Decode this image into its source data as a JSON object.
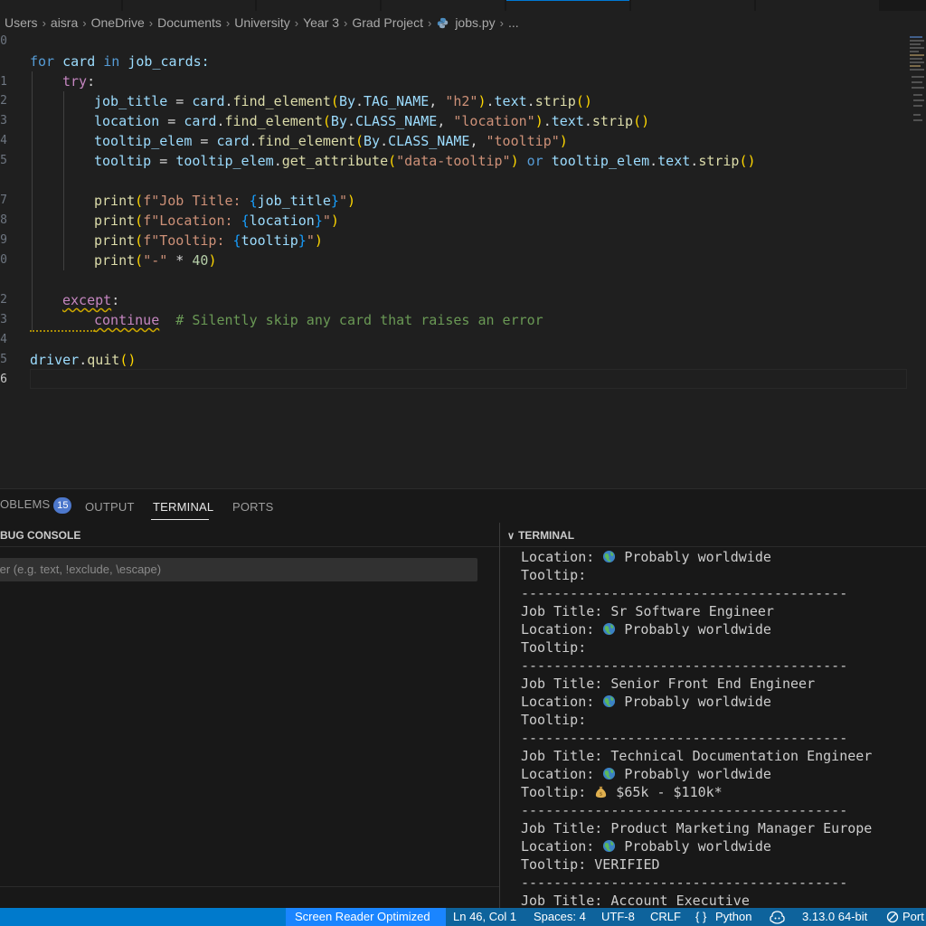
{
  "breadcrumb": [
    "Users",
    "aisra",
    "OneDrive",
    "Documents",
    "University",
    "Year 3",
    "Grad Project",
    "jobs.py",
    "..."
  ],
  "editor": {
    "line_numbers": [
      "0",
      "1",
      "2",
      "3",
      "4",
      "5",
      "",
      "7",
      "8",
      "9",
      "0",
      "",
      "2",
      "3",
      "4",
      "5",
      "6"
    ],
    "code": {
      "l0": [
        "for",
        " card ",
        "in",
        " job_cards:"
      ],
      "l1": [
        "try",
        ":"
      ],
      "l2": [
        "job_title",
        " = ",
        "card",
        ".",
        "find_element",
        "(",
        "By",
        ".",
        "TAG_NAME",
        ", ",
        "\"h2\"",
        ")",
        ".",
        "text",
        ".",
        "strip",
        "()"
      ],
      "l3": [
        "location",
        " = ",
        "card",
        ".",
        "find_element",
        "(",
        "By",
        ".",
        "CLASS_NAME",
        ", ",
        "\"location\"",
        ")",
        ".",
        "text",
        ".",
        "strip",
        "()"
      ],
      "l4": [
        "tooltip_elem",
        " = ",
        "card",
        ".",
        "find_element",
        "(",
        "By",
        ".",
        "CLASS_NAME",
        ", ",
        "\"tooltip\"",
        ")"
      ],
      "l5": [
        "tooltip",
        " = ",
        "tooltip_elem",
        ".",
        "get_attribute",
        "(",
        "\"data-tooltip\"",
        ") ",
        "or",
        " tooltip_elem",
        ".",
        "text",
        ".",
        "strip",
        "()"
      ],
      "l7": [
        "print",
        "(",
        "f\"Job Title: ",
        "{",
        "job_title",
        "}",
        "\"",
        ")"
      ],
      "l8": [
        "print",
        "(",
        "f\"Location: ",
        "{",
        "location",
        "}",
        "\"",
        ")"
      ],
      "l9": [
        "print",
        "(",
        "f\"Tooltip: ",
        "{",
        "tooltip",
        "}",
        "\"",
        ")"
      ],
      "l10": [
        "print",
        "(",
        "\"-\"",
        " * ",
        "40",
        ")"
      ],
      "l12": [
        "except",
        ":"
      ],
      "l13": [
        "continue",
        "  # Silently skip any card that raises an error"
      ],
      "l15": [
        "driver",
        ".",
        "quit",
        "()"
      ]
    }
  },
  "panel": {
    "tabs": [
      {
        "label": "OBLEMS"
      },
      {
        "label": "OUTPUT"
      },
      {
        "label": "TERMINAL"
      },
      {
        "label": "PORTS"
      }
    ],
    "problems_count": "15",
    "debug_header": "BUG CONSOLE",
    "debug_filter_placeholder": "ter (e.g. text, !exclude, \\escape)",
    "terminal_header": "TERMINAL",
    "terminal_lines": [
      {
        "text": "Location: ",
        "emoji": "globe",
        "rest": " Probably worldwide"
      },
      {
        "text": "Tooltip:"
      },
      {
        "text": "----------------------------------------"
      },
      {
        "text": "Job Title: Sr Software Engineer"
      },
      {
        "text": "Location: ",
        "emoji": "globe",
        "rest": " Probably worldwide"
      },
      {
        "text": "Tooltip:"
      },
      {
        "text": "----------------------------------------"
      },
      {
        "text": "Job Title: Senior Front End Engineer"
      },
      {
        "text": "Location: ",
        "emoji": "globe",
        "rest": " Probably worldwide"
      },
      {
        "text": "Tooltip:"
      },
      {
        "text": "----------------------------------------"
      },
      {
        "text": "Job Title: Technical Documentation Engineer"
      },
      {
        "text": "Location: ",
        "emoji": "globe",
        "rest": " Probably worldwide"
      },
      {
        "text": "Tooltip: ",
        "emoji": "money-bag",
        "rest": " $65k - $110k*"
      },
      {
        "text": "----------------------------------------"
      },
      {
        "text": "Job Title: Product Marketing Manager Europe"
      },
      {
        "text": "Location: ",
        "emoji": "globe",
        "rest": " Probably worldwide"
      },
      {
        "text": "Tooltip: VERIFIED"
      },
      {
        "text": "----------------------------------------"
      },
      {
        "text": "Job Title: Account Executive"
      }
    ]
  },
  "statusbar": {
    "screen_reader": "Screen Reader Optimized",
    "position": "Ln 46, Col 1",
    "spaces": "Spaces: 4",
    "encoding": "UTF-8",
    "eol": "CRLF",
    "language": "Python",
    "language_icon": "{ }",
    "interpreter": "3.13.0 64-bit",
    "ports": "Port"
  },
  "colors": {
    "status_bar": "#0e639c",
    "accent": "#007acc",
    "badge": "#4d78cc"
  }
}
